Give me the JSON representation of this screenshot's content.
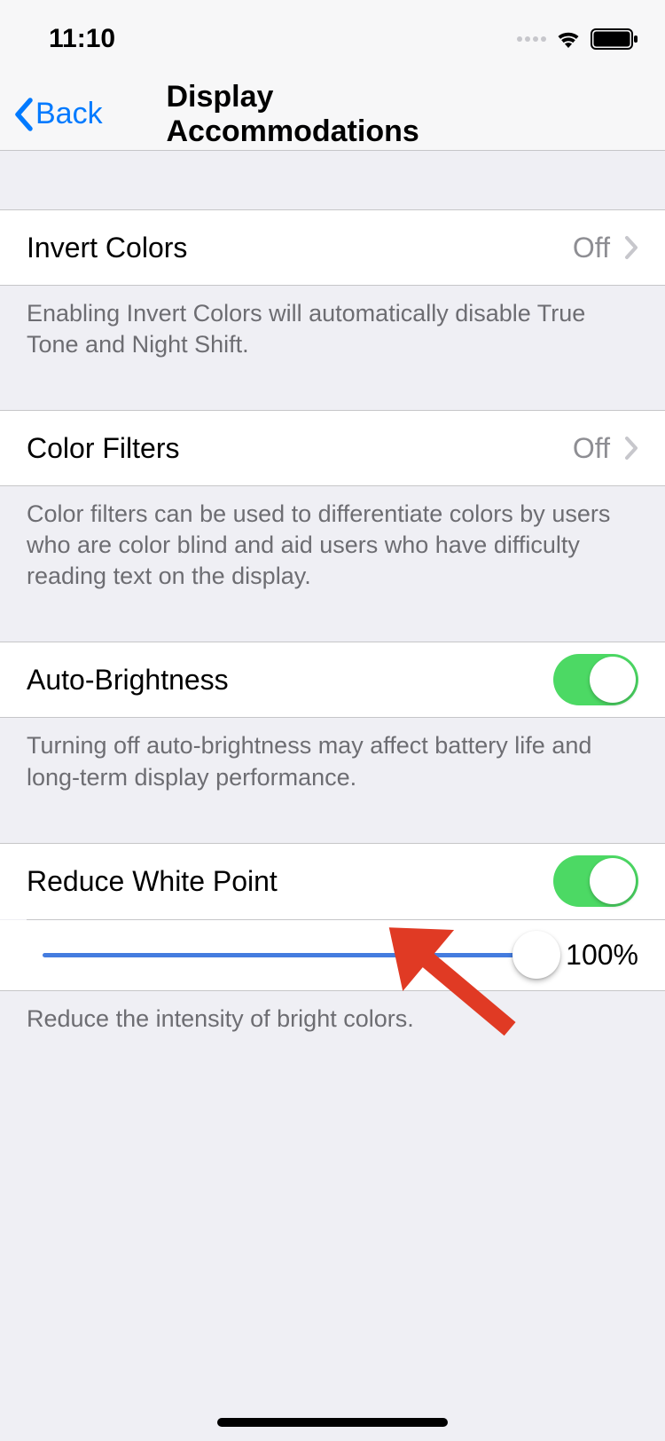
{
  "status": {
    "time": "11:10"
  },
  "nav": {
    "back_label": "Back",
    "title": "Display Accommodations"
  },
  "rows": {
    "invert_colors": {
      "label": "Invert Colors",
      "value": "Off",
      "footer": "Enabling Invert Colors will automatically disable True Tone and Night Shift."
    },
    "color_filters": {
      "label": "Color Filters",
      "value": "Off",
      "footer": "Color filters can be used to differentiate colors by users who are color blind and aid users who have difficulty reading text on the display."
    },
    "auto_brightness": {
      "label": "Auto-Brightness",
      "enabled": true,
      "footer": "Turning off auto-brightness may affect battery life and long-term display performance."
    },
    "reduce_white_point": {
      "label": "Reduce White Point",
      "enabled": true,
      "slider_value": "100%",
      "footer": "Reduce the intensity of bright colors."
    }
  }
}
